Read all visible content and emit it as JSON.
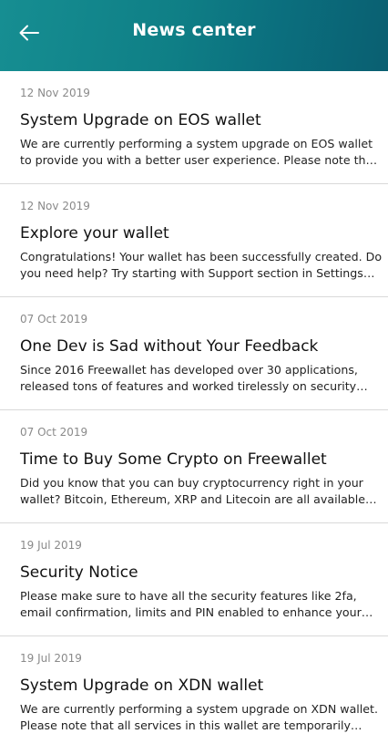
{
  "header": {
    "title": "News center",
    "back_icon": "arrow-left-icon",
    "gradient_colors": [
      "#168e92",
      "#0a5f71"
    ]
  },
  "news": [
    {
      "date": "12 Nov 2019",
      "title": "System Upgrade on EOS wallet",
      "text": "We are currently performing a system upgrade on EOS wallet to provide you with a better user experience. Please note that all…"
    },
    {
      "date": "12 Nov 2019",
      "title": "Explore your wallet",
      "text": "Congratulations! Your wallet has been successfully created. Do you need help? Try starting with Support section in Settings or…"
    },
    {
      "date": "07 Oct 2019",
      "title": "One Dev is Sad without Your Feedback",
      "text": "Since 2016 Freewallet has developed over 30 applications, released tons of features and worked tirelessly on security an…"
    },
    {
      "date": "07 Oct 2019",
      "title": "Time to Buy Some Crypto on Freewallet",
      "text": "Did you know that you can buy cryptocurrency right in your wallet? Bitcoin, Ethereum, XRP and Litecoin are all available o…"
    },
    {
      "date": "19 Jul 2019",
      "title": "Security Notice",
      "text": "Please make sure to have all the security features like 2fa, email confirmation, limits and PIN enabled to enhance your account…"
    },
    {
      "date": "19 Jul 2019",
      "title": "System Upgrade on XDN wallet",
      "text": "We are currently performing a system upgrade on XDN wallet. Please note that all services in this wallet are temporarily…"
    }
  ]
}
